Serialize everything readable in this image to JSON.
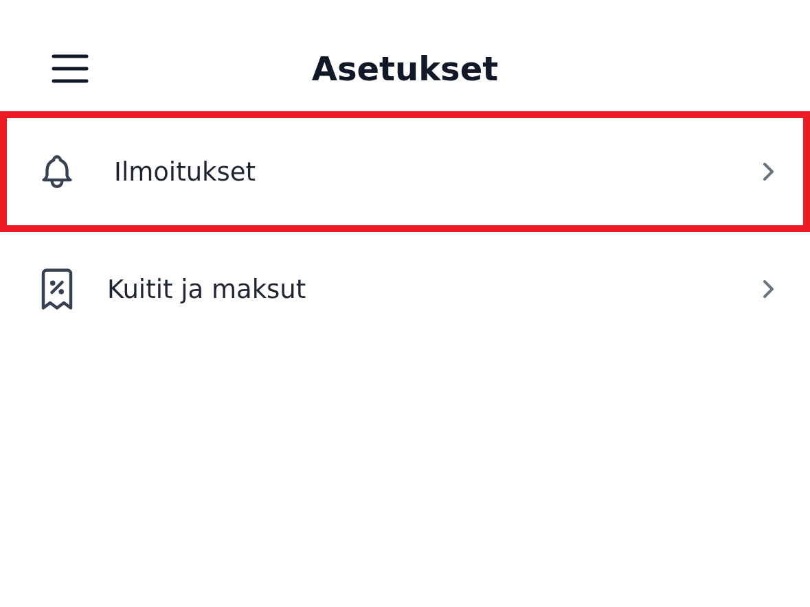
{
  "header": {
    "title": "Asetukset"
  },
  "items": [
    {
      "kind": "bell",
      "label": "Ilmoitukset",
      "highlighted": true
    },
    {
      "kind": "receipt",
      "label": "Kuitit ja maksut",
      "highlighted": false
    }
  ]
}
